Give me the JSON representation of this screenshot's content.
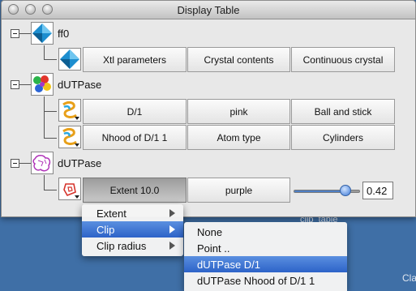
{
  "window": {
    "title": "Display Table"
  },
  "tree": {
    "node1": {
      "label": "ff0",
      "row": {
        "cells": [
          "Xtl parameters",
          "Crystal contents",
          "Continuous crystal"
        ]
      }
    },
    "node2": {
      "label": "dUTPase",
      "rows": [
        {
          "cells": [
            "D/1",
            "pink",
            "Ball and stick"
          ]
        },
        {
          "cells": [
            "Nhood of D/1 1",
            "Atom type",
            "Cylinders"
          ]
        }
      ]
    },
    "node3": {
      "label": "dUTPase",
      "row": {
        "cells": [
          "Extent 10.0",
          "purple"
        ],
        "slider_level": 0.78,
        "value": "0.42"
      }
    }
  },
  "context_menu": {
    "items": [
      {
        "label": "Extent"
      },
      {
        "label": "Clip"
      },
      {
        "label": "Clip radius"
      }
    ]
  },
  "submenu": {
    "items": [
      {
        "label": "None"
      },
      {
        "label": "Point .."
      },
      {
        "label": "dUTPase D/1"
      },
      {
        "label": "dUTPase Nhood of D/1 1"
      }
    ]
  },
  "desktop": {
    "window_label": "clip_table",
    "corner_label": "Cla"
  },
  "colors": {
    "selection": "#2d63c8",
    "slider": "#4e7fc4",
    "desktop": "#3f6fa6"
  }
}
